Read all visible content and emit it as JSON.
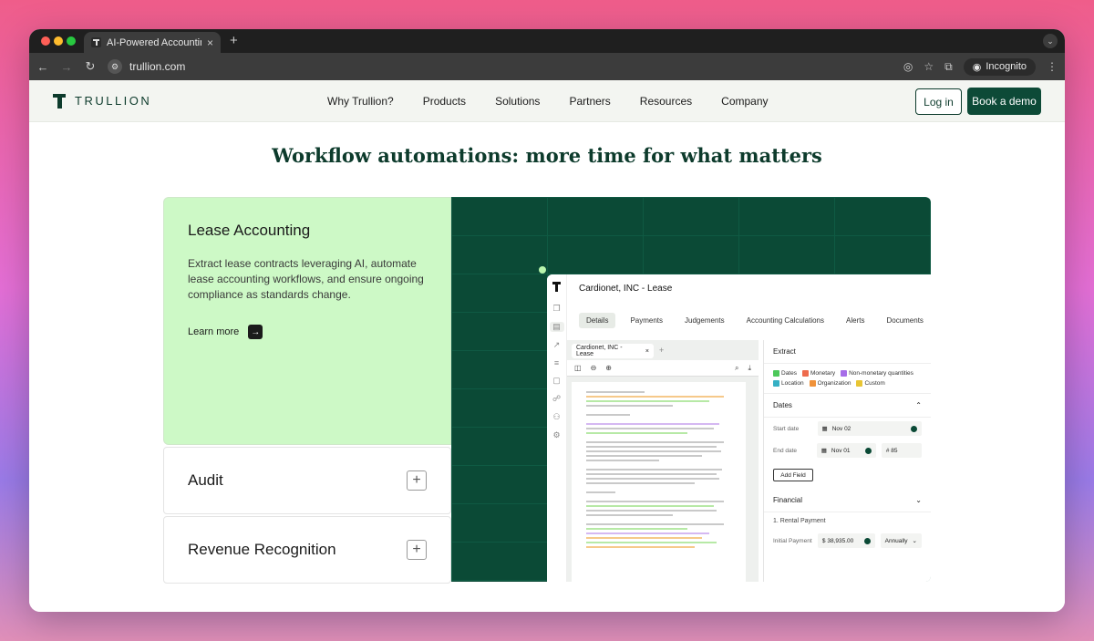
{
  "browser": {
    "tab_title": "AI-Powered Accounting Softw",
    "tab_close": "×",
    "new_tab": "+",
    "url": "trullion.com",
    "incognito_label": "Incognito"
  },
  "site": {
    "logo_text": "TRULLION",
    "menu": [
      "Why Trullion?",
      "Products",
      "Solutions",
      "Partners",
      "Resources",
      "Company"
    ],
    "login_label": "Log in",
    "demo_label": "Book a demo"
  },
  "page": {
    "headline": "Workflow automations: more time for what matters",
    "active_card": {
      "title": "Lease Accounting",
      "description": "Extract lease contracts leveraging AI, automate lease accounting workflows, and ensure ongoing compliance as standards change.",
      "learn_more": "Learn more"
    },
    "cards": [
      {
        "title": "Audit"
      },
      {
        "title": "Revenue Recognition"
      }
    ]
  },
  "app": {
    "title": "Cardionet, INC - Lease",
    "tabs": [
      "Details",
      "Payments",
      "Judgements",
      "Accounting Calculations",
      "Alerts",
      "Documents"
    ],
    "doc_tab": "Cardionet, INC - Lease",
    "extract_header": "Extract",
    "filters": [
      {
        "label": "Dates",
        "color": "#4cc85a"
      },
      {
        "label": "Monetary",
        "color": "#ee6b4d"
      },
      {
        "label": "Non-monetary quantities",
        "color": "#a66de8"
      },
      {
        "label": "Location",
        "color": "#35b0c4"
      },
      {
        "label": "Organization",
        "color": "#f0923a"
      },
      {
        "label": "Custom",
        "color": "#e8c534"
      }
    ],
    "dates_section": "Dates",
    "start_date_label": "Start date",
    "start_date_value": "Nov 02",
    "end_date_label": "End date",
    "end_date_value": "Nov 01",
    "end_date_extra": "# 85",
    "add_field": "Add Field",
    "financial_section": "Financial",
    "rental_payment": "1. Rental Payment",
    "initial_payment_label": "Initial Payment",
    "initial_payment_value": "$ 38,935.00",
    "frequency": "Annually"
  }
}
